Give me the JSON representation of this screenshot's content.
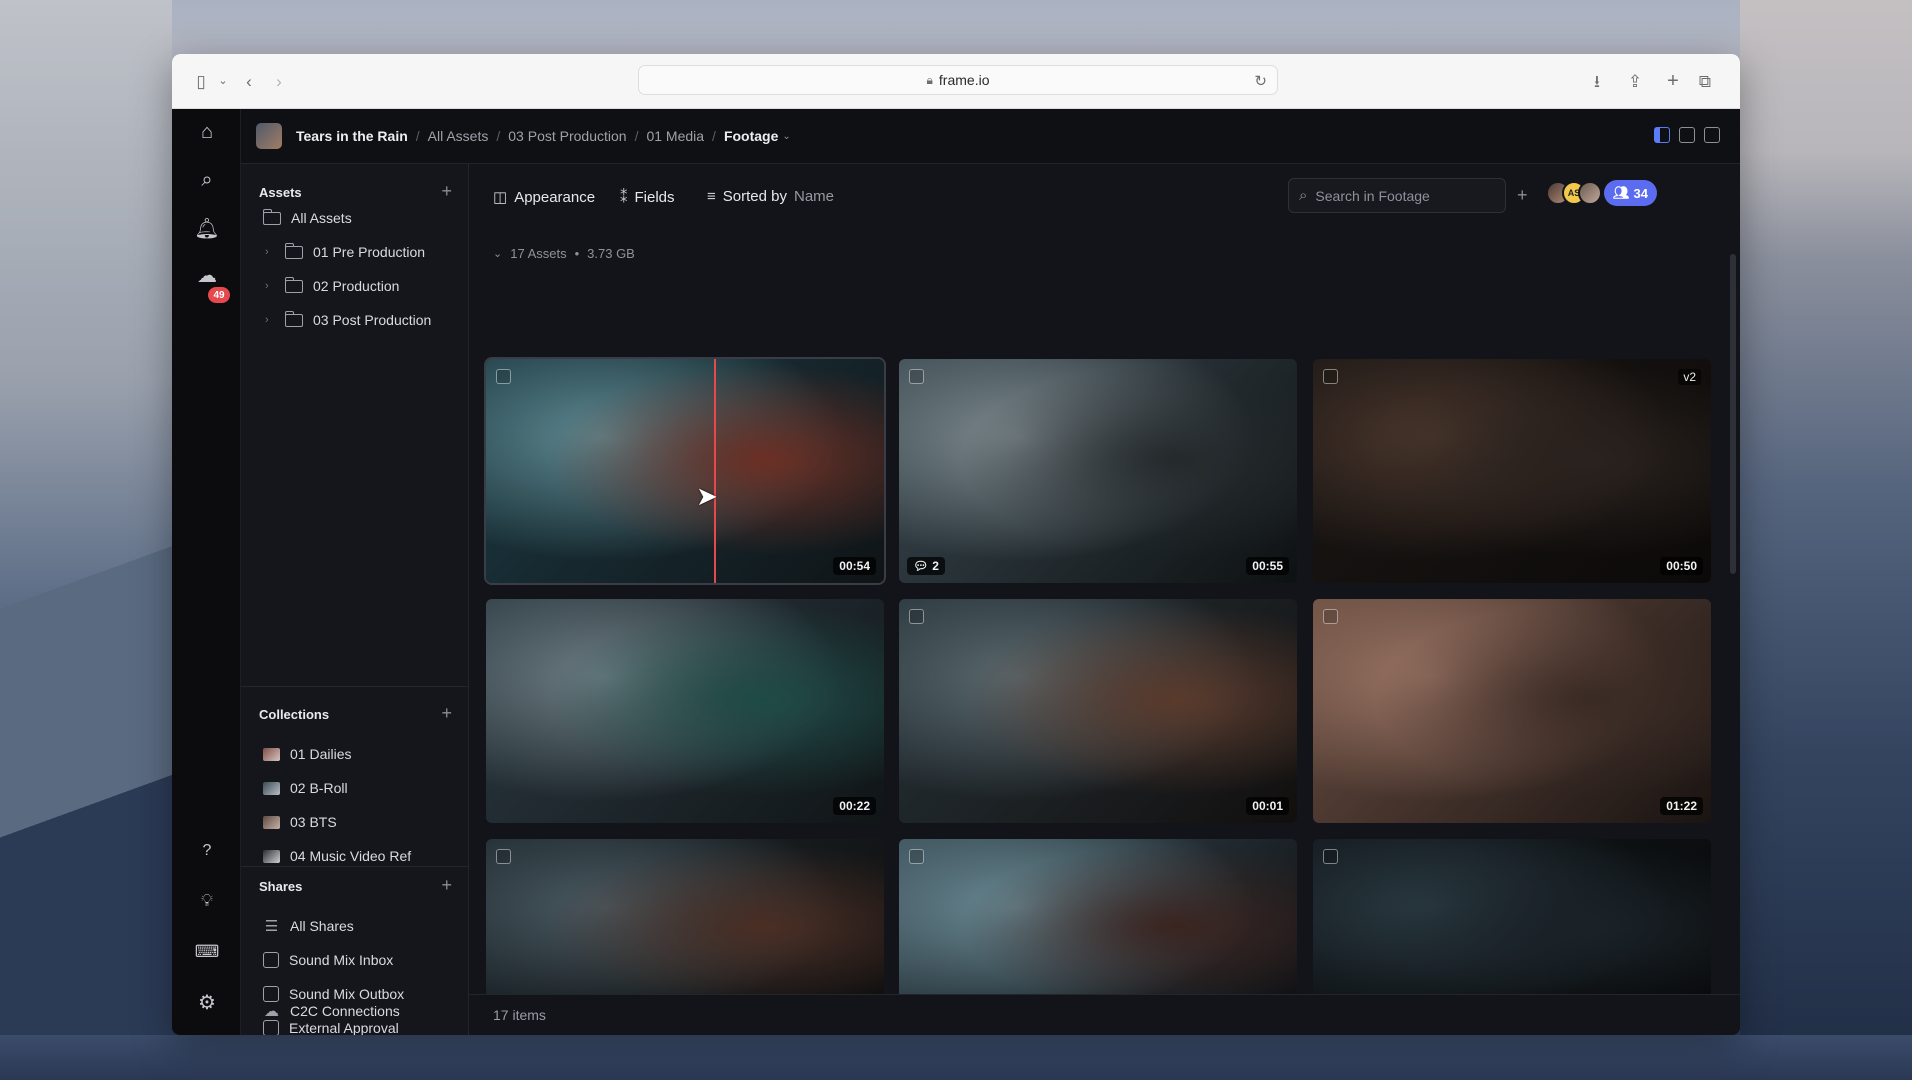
{
  "browser": {
    "url": "frame.io"
  },
  "rail": {
    "notification_count": "49"
  },
  "breadcrumb": {
    "items": [
      "Tears in the Rain",
      "All Assets",
      "03 Post Production",
      "01 Media"
    ],
    "current": "Footage"
  },
  "sidebar": {
    "assets_title": "Assets",
    "assets": [
      {
        "label": "All Assets"
      },
      {
        "label": "01 Pre Production"
      },
      {
        "label": "02 Production"
      },
      {
        "label": "03 Post Production"
      }
    ],
    "collections_title": "Collections",
    "collections": [
      {
        "label": "01 Dailies"
      },
      {
        "label": "02 B-Roll"
      },
      {
        "label": "03 BTS"
      },
      {
        "label": "04 Music Video Ref"
      }
    ],
    "shares_title": "Shares",
    "shares": [
      {
        "label": "All Shares"
      },
      {
        "label": "Sound Mix Inbox"
      },
      {
        "label": "Sound Mix Outbox"
      },
      {
        "label": "External Approval"
      }
    ],
    "c2c_label": "C2C Connections"
  },
  "toolbar": {
    "appearance": "Appearance",
    "fields": "Fields",
    "sorted_by": "Sorted by",
    "sort_value": "Name",
    "search_placeholder": "Search in Footage",
    "avatar_initials": "AS",
    "member_count": "34"
  },
  "summary": {
    "count": "17 Assets",
    "dot": "•",
    "size": "3.73 GB"
  },
  "assets": [
    {
      "duration": "00:54",
      "colors": [
        "#1c3a44",
        "#5f8a92",
        "#6b2f24",
        "#0f1416"
      ]
    },
    {
      "duration": "00:55",
      "comments": "2",
      "colors": [
        "#3a4a52",
        "#7e8a8e",
        "#24292c",
        "#0e1112"
      ]
    },
    {
      "duration": "00:50",
      "version": "v2",
      "colors": [
        "#1a1614",
        "#4a362c",
        "#2a221e",
        "#0c0a09"
      ]
    },
    {
      "duration": "00:22",
      "colors": [
        "#2c3a42",
        "#6e7e84",
        "#1e4a46",
        "#101517"
      ]
    },
    {
      "duration": "00:01",
      "colors": [
        "#26333a",
        "#5a6a70",
        "#5a3a2c",
        "#120f0e"
      ]
    },
    {
      "duration": "01:22",
      "colors": [
        "#6a4e42",
        "#9a7464",
        "#3a2a24",
        "#1a1412"
      ]
    },
    {
      "colors": [
        "#1e2a30",
        "#4a5a62",
        "#4a2e24",
        "#0e0c0c"
      ]
    },
    {
      "colors": [
        "#3a4e58",
        "#6a8a94",
        "#3a2420",
        "#0c0c0e"
      ]
    },
    {
      "colors": [
        "#12181c",
        "#2a3a42",
        "#1a2228",
        "#08090a"
      ]
    }
  ],
  "footer": {
    "items": "17 items"
  }
}
